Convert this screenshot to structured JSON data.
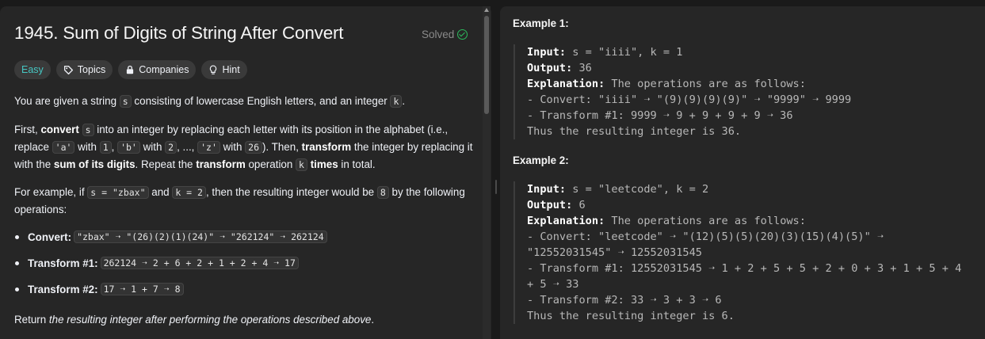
{
  "problem": {
    "title": "1945. Sum of Digits of String After Convert",
    "status": "Solved",
    "tags": [
      {
        "label": "Easy",
        "icon": ""
      },
      {
        "label": "Topics",
        "icon": "tag-icon"
      },
      {
        "label": "Companies",
        "icon": "lock-icon"
      },
      {
        "label": "Hint",
        "icon": "lightbulb-icon"
      }
    ]
  },
  "desc": {
    "p1_a": "You are given a string ",
    "p1_s": "s",
    "p1_b": " consisting of lowercase English letters, and an integer ",
    "p1_k": "k",
    "p1_c": ".",
    "p2_a": "First, ",
    "p2_convert": "convert",
    "p2_s": "s",
    "p2_b": " into an integer by replacing each letter with its position in the alphabet (i.e., replace ",
    "p2_a_code": "'a'",
    "p2_with1": " with ",
    "p2_1": "1",
    "p2_comma1": ", ",
    "p2_b_code": "'b'",
    "p2_with2": " with ",
    "p2_2": "2",
    "p2_dots": ", ..., ",
    "p2_z_code": "'z'",
    "p2_with3": " with ",
    "p2_26": "26",
    "p2_c": "). Then, ",
    "p2_transform": "transform",
    "p2_d": " the integer by replacing it with the ",
    "p2_sum": "sum of its digits",
    "p2_e": ". Repeat the ",
    "p2_transform2": "transform",
    "p2_f": " operation ",
    "p2_k": "k",
    "p2_times": "times",
    "p2_g": " in total.",
    "p3_a": "For example, if ",
    "p3_s": "s = \"zbax\"",
    "p3_and": " and ",
    "p3_k": "k = 2",
    "p3_b": ", then the resulting integer would be ",
    "p3_8": "8",
    "p3_c": " by the following operations:",
    "bullets": [
      {
        "label": "Convert:",
        "code": "\"zbax\" ➝ \"(26)(2)(1)(24)\" ➝ \"262124\" ➝ 262124"
      },
      {
        "label": "Transform #1:",
        "code": "262124 ➝ 2 + 6 + 2 + 1 + 2 + 4 ➝ 17"
      },
      {
        "label": "Transform #2:",
        "code": "17 ➝ 1 + 7 ➝ 8"
      }
    ],
    "p4_a": "Return ",
    "p4_i": "the resulting integer after performing the operations described above",
    "p4_b": "."
  },
  "examples": [
    {
      "heading": "Example 1:",
      "input_label": "Input:",
      "input_value": " s = \"iiii\", k = 1",
      "output_label": "Output:",
      "output_value": " 36",
      "explanation_label": "Explanation:",
      "explanation_lines": [
        " The operations are as follows:",
        "- Convert: \"iiii\" ➝ \"(9)(9)(9)(9)\" ➝ \"9999\" ➝ 9999",
        "- Transform #1: 9999 ➝ 9 + 9 + 9 + 9 ➝ 36",
        "Thus the resulting integer is 36."
      ]
    },
    {
      "heading": "Example 2:",
      "input_label": "Input:",
      "input_value": " s = \"leetcode\", k = 2",
      "output_label": "Output:",
      "output_value": " 6",
      "explanation_label": "Explanation:",
      "explanation_lines": [
        " The operations are as follows:",
        "- Convert: \"leetcode\" ➝ \"(12)(5)(5)(20)(3)(15)(4)(5)\" ➝",
        "\"12552031545\" ➝ 12552031545",
        "- Transform #1: 12552031545 ➝ 1 + 2 + 5 + 5 + 2 + 0 + 3 + 1 + 5 + 4",
        "+ 5 ➝ 33",
        "- Transform #2: 33 ➝ 3 + 3 ➝ 6",
        "Thus the resulting integer is 6."
      ]
    }
  ],
  "colors": {
    "easy": "#46c6c2",
    "solved": "#2cbb5d",
    "panel": "#262626",
    "background": "#1a1a1a"
  }
}
